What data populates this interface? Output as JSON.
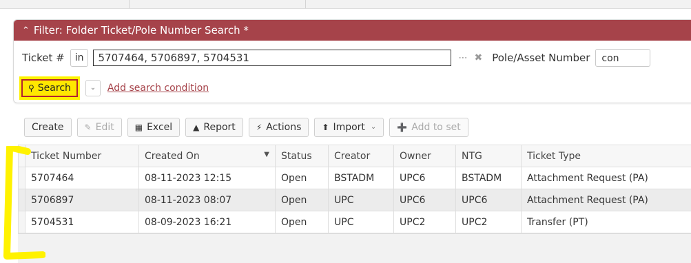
{
  "filter": {
    "title": "Filter: Folder Ticket/Pole Number Search *",
    "ticket_label": "Ticket #",
    "ticket_operator": "in",
    "ticket_value": "5707464, 5706897, 5704531",
    "dots": "⋯",
    "pole_label": "Pole/Asset Number",
    "pole_operator": "con",
    "search_label": "Search",
    "add_condition": "Add search condition"
  },
  "toolbar": {
    "create": "Create",
    "edit": "Edit",
    "excel": "Excel",
    "report": "Report",
    "actions": "Actions",
    "import": "Import",
    "add_to_set": "Add to set"
  },
  "table": {
    "columns": [
      "Ticket Number",
      "Created On",
      "Status",
      "Creator",
      "Owner",
      "NTG",
      "Ticket Type"
    ],
    "rows": [
      [
        "5707464",
        "08-11-2023 12:15",
        "Open",
        "BSTADM",
        "UPC6",
        "BSTADM",
        "Attachment Request (PA)"
      ],
      [
        "5706897",
        "08-11-2023 08:07",
        "Open",
        "UPC",
        "UPC6",
        "UPC6",
        "Attachment Request (PA)"
      ],
      [
        "5704531",
        "08-09-2023 16:21",
        "Open",
        "UPC",
        "UPC2",
        "UPC2",
        "Transfer (PT)"
      ]
    ]
  },
  "colors": {
    "header_red": "#a6434a",
    "highlight_yellow": "#fff200",
    "search_border": "#b3242f"
  }
}
